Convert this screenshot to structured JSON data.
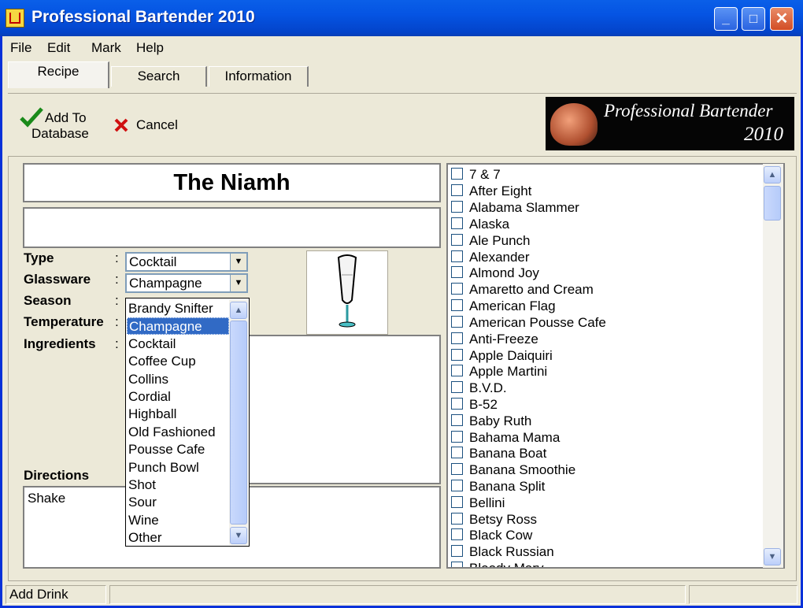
{
  "window": {
    "title": "Professional Bartender 2010",
    "buttons": {
      "minimize": "_",
      "maximize": "□",
      "close": "✕"
    }
  },
  "menu": [
    "File",
    "Edit",
    "Mark",
    "Help"
  ],
  "tabs": [
    "Recipe",
    "Search",
    "Information"
  ],
  "toolbar": {
    "add_label_1": "Add To",
    "add_label_2": "Database",
    "cancel_label": "Cancel"
  },
  "logo": {
    "line1": "Professional Bartender",
    "line2": "2010"
  },
  "recipe": {
    "name": "The Niamh",
    "labels": {
      "type": "Type",
      "glassware": "Glassware",
      "season": "Season",
      "temperature": "Temperature",
      "ingredients": "Ingredients",
      "directions": "Directions"
    },
    "colon": ":",
    "type_value": "Cocktail",
    "glassware_value": "Champagne",
    "directions_text": "Shake"
  },
  "glass_dropdown": {
    "options": [
      "Brandy Snifter",
      "Champagne",
      "Cocktail",
      "Coffee Cup",
      "Collins",
      "Cordial",
      "Highball",
      "Old Fashioned",
      "Pousse Cafe",
      "Punch Bowl",
      "Shot",
      "Sour",
      "Wine",
      "Other"
    ],
    "selected": "Champagne"
  },
  "drink_list": [
    "7 & 7",
    "After Eight",
    "Alabama Slammer",
    "Alaska",
    "Ale Punch",
    "Alexander",
    "Almond Joy",
    "Amaretto and Cream",
    "American Flag",
    "American Pousse Cafe",
    "Anti-Freeze",
    "Apple Daiquiri",
    "Apple Martini",
    "B.V.D.",
    "B-52",
    "Baby Ruth",
    "Bahama Mama",
    "Banana Boat",
    "Banana Smoothie",
    "Banana Split",
    "Bellini",
    "Betsy Ross",
    "Black Cow",
    "Black Russian",
    "Bloody Mary"
  ],
  "status": {
    "left": "Add Drink",
    "middle": "",
    "right": ""
  },
  "icons": {
    "add": "checkmark-icon",
    "cancel": "x-icon",
    "glass": "champagne-glass-icon"
  },
  "colors": {
    "title_blue": "#0554e3",
    "selection": "#316ac5",
    "check_green": "#1a8a1a",
    "cancel_red": "#d01010"
  }
}
